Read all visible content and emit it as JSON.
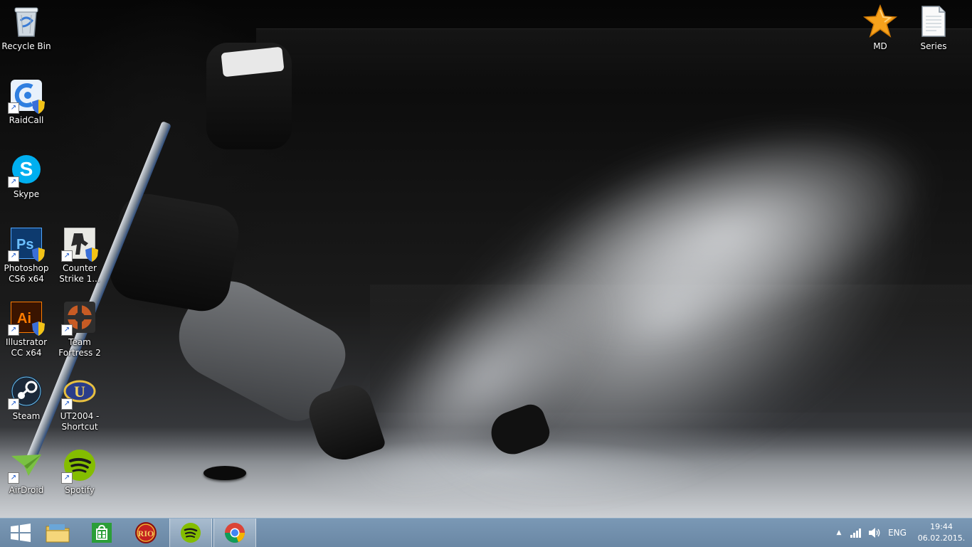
{
  "desktop": {
    "icons": [
      {
        "label": "Recycle Bin",
        "icon": "recycle-bin-icon"
      },
      {
        "label": "RaidCall",
        "icon": "raidcall-icon"
      },
      {
        "label": "Skype",
        "icon": "skype-icon"
      },
      {
        "label": "Photoshop CS6 x64",
        "icon": "photoshop-icon"
      },
      {
        "label": "Counter Strike 1...",
        "icon": "counter-strike-icon"
      },
      {
        "label": "Illustrator CC x64",
        "icon": "illustrator-icon"
      },
      {
        "label": "Team Fortress 2",
        "icon": "team-fortress-icon"
      },
      {
        "label": "Steam",
        "icon": "steam-icon"
      },
      {
        "label": "UT2004 - Shortcut",
        "icon": "ut2004-icon"
      },
      {
        "label": "AirDroid",
        "icon": "airdroid-icon"
      },
      {
        "label": "Spotify",
        "icon": "spotify-icon"
      },
      {
        "label": "MD",
        "icon": "star-folder-icon"
      },
      {
        "label": "Series",
        "icon": "text-document-icon"
      }
    ]
  },
  "taskbar": {
    "buttons": [
      {
        "icon": "windows-start-icon"
      },
      {
        "icon": "file-explorer-icon"
      },
      {
        "icon": "windows-store-icon"
      },
      {
        "icon": "rio-app-icon"
      },
      {
        "icon": "spotify-icon",
        "active": true
      },
      {
        "icon": "chrome-icon",
        "active": true
      }
    ],
    "tray": {
      "show_hidden": "▲",
      "language": "ENG",
      "time": "19:44",
      "date": "06.02.2015."
    }
  },
  "colors": {
    "taskbar": "#6f8dab",
    "photoshop": "#0d3a6e",
    "illustrator": "#ff7c00",
    "spotify": "#84bd00",
    "skype": "#00aff0",
    "store": "#2b9e38"
  }
}
